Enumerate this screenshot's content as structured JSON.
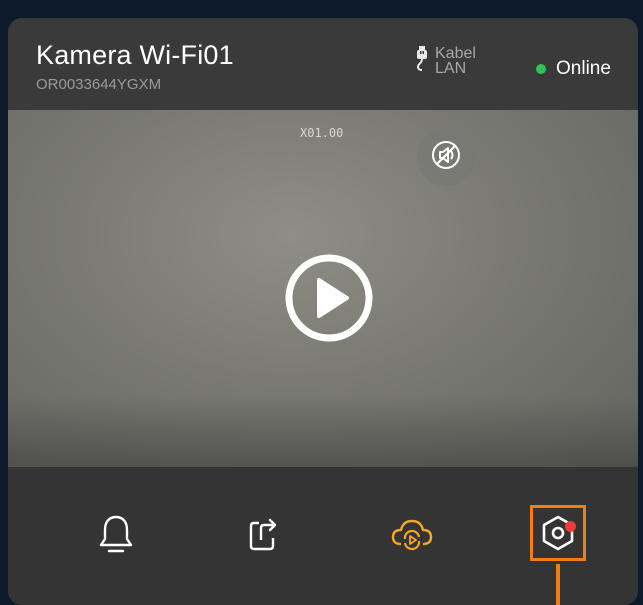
{
  "camera": {
    "name": "Kamera Wi-Fi01",
    "serial": "OR0033644YGXM"
  },
  "connection": {
    "label_line1": "Kabel",
    "label_line2": "LAN",
    "icon": "ethernet-plug-icon"
  },
  "status": {
    "text": "Online",
    "color": "#2fc35a"
  },
  "video": {
    "zoom_text": "X01.00",
    "mute_icon": "audio-off-icon",
    "play_icon": "play-circle-icon"
  },
  "toolbar": {
    "items": [
      {
        "name": "alarm",
        "icon": "bell-icon"
      },
      {
        "name": "share",
        "icon": "share-icon"
      },
      {
        "name": "cloud-playback",
        "icon": "cloud-playback-icon",
        "color": "#f5a623"
      },
      {
        "name": "settings",
        "icon": "settings-hex-icon",
        "highlight_color": "#f07f14",
        "badge_color": "#f23b3b"
      }
    ]
  }
}
